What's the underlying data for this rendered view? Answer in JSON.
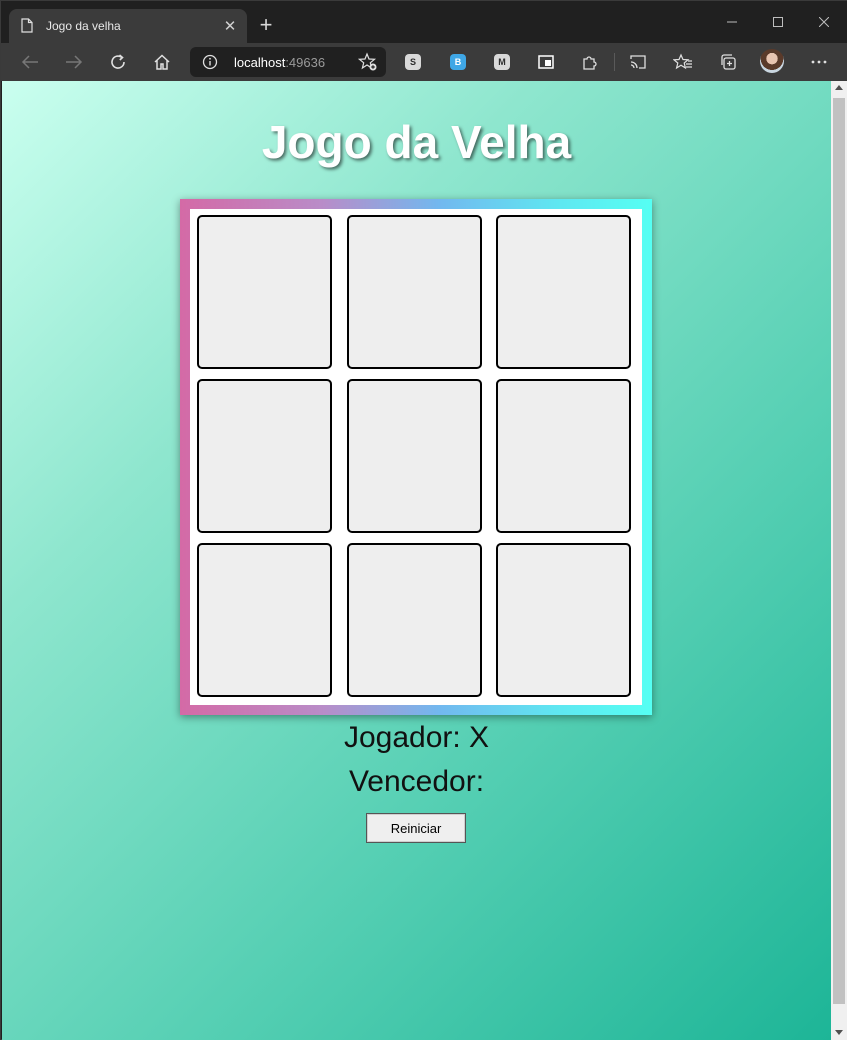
{
  "browser": {
    "tab_title": "Jogo da velha",
    "tab_close": "✕",
    "new_tab": "+",
    "address_host": "localhost",
    "address_port": ":49636",
    "extensions": [
      {
        "name": "s-extension",
        "glyph": "S",
        "color": "#d9d9d9"
      },
      {
        "name": "b-extension",
        "glyph": "B",
        "color": "#3fa7e6"
      },
      {
        "name": "m-extension",
        "glyph": "M",
        "color": "#d9d9d9"
      },
      {
        "name": "window-extension",
        "glyph": "▣",
        "color": "#ffffff"
      }
    ]
  },
  "page": {
    "title": "Jogo da Velha",
    "board": {
      "cells": [
        "",
        "",
        "",
        "",
        "",
        "",
        "",
        "",
        ""
      ]
    },
    "player_text": "Jogador: X",
    "winner_text": "Vencedor: ",
    "restart_label": "Reiniciar"
  },
  "colors": {
    "background_gradient": [
      "#caffef",
      "#1db597"
    ],
    "frame_gradient": [
      "#d46aa6",
      "#55fff3"
    ],
    "cell_bg": "#eeeeee"
  }
}
